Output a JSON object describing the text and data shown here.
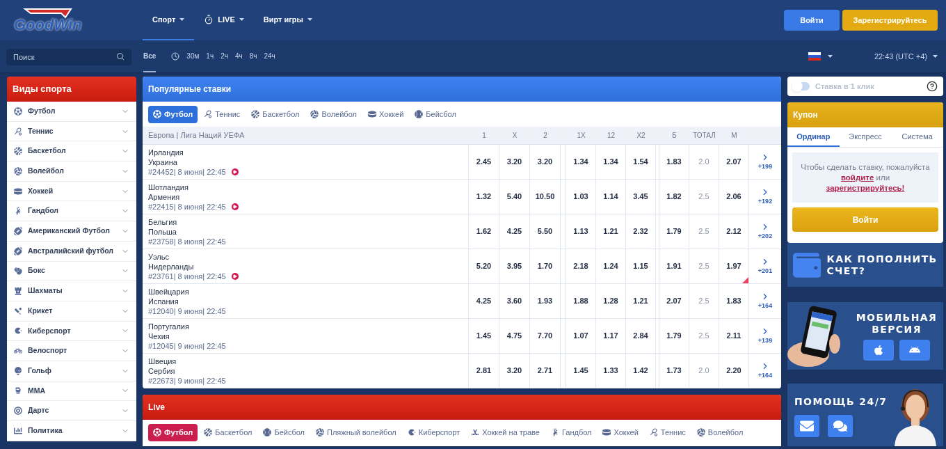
{
  "header": {
    "logo": {
      "part1": "Good",
      "part2": "Win"
    },
    "nav": [
      {
        "label": "Спорт",
        "selected": true,
        "kind": "plain"
      },
      {
        "label": "LIVE",
        "selected": false,
        "kind": "live"
      },
      {
        "label": "Вирт игры",
        "selected": false,
        "kind": "plain"
      }
    ],
    "login": "Войти",
    "register": "Зарегистрируйтесь"
  },
  "subbar": {
    "search": {
      "placeholder": "Поиск"
    },
    "filters": [
      {
        "label": "Все",
        "selected": true
      },
      {
        "label": "30м",
        "selected": false
      },
      {
        "label": "1ч",
        "selected": false
      },
      {
        "label": "2ч",
        "selected": false
      },
      {
        "label": "4ч",
        "selected": false
      },
      {
        "label": "8ч",
        "selected": false
      },
      {
        "label": "24ч",
        "selected": false
      }
    ],
    "time": "22:43 (UTC +4)"
  },
  "sidebar": {
    "title": "Виды спорта",
    "items": [
      {
        "label": "Футбол",
        "kind": "football"
      },
      {
        "label": "Теннис",
        "kind": "tennis"
      },
      {
        "label": "Баскетбол",
        "kind": "basketball"
      },
      {
        "label": "Волейбол",
        "kind": "volleyball"
      },
      {
        "label": "Хоккей",
        "kind": "hockey"
      },
      {
        "label": "Гандбол",
        "kind": "handball"
      },
      {
        "label": "Американский Футбол",
        "kind": "american"
      },
      {
        "label": "Австралийский футбол",
        "kind": "american"
      },
      {
        "label": "Бокс",
        "kind": "boxing"
      },
      {
        "label": "Шахматы",
        "kind": "chess"
      },
      {
        "label": "Крикет",
        "kind": "cricket"
      },
      {
        "label": "Киберспорт",
        "kind": "esports"
      },
      {
        "label": "Велоспорт",
        "kind": "cycling"
      },
      {
        "label": "Гольф",
        "kind": "golf"
      },
      {
        "label": "MMA",
        "kind": "mma"
      },
      {
        "label": "Дартс",
        "kind": "darts"
      },
      {
        "label": "Политика",
        "kind": "politics"
      }
    ]
  },
  "popular": {
    "title": "Популярные ставки",
    "tabs": [
      {
        "label": "Футбол",
        "kind": "football",
        "selected": true
      },
      {
        "label": "Теннис",
        "kind": "tennis",
        "selected": false
      },
      {
        "label": "Баскетбол",
        "kind": "basketball",
        "selected": false
      },
      {
        "label": "Волейбол",
        "kind": "volleyball",
        "selected": false
      },
      {
        "label": "Хоккей",
        "kind": "hockey",
        "selected": false
      },
      {
        "label": "Бейсбол",
        "kind": "baseball",
        "selected": false
      }
    ],
    "league": "Европа | Лига Наций УЕФА",
    "columns": [
      "1",
      "X",
      "2",
      "1X",
      "12",
      "X2",
      "Б",
      "ТОТАЛ",
      "М"
    ],
    "rows": [
      {
        "team1": "Ирландия",
        "team2": "Украина",
        "meta": "#24452| 8 июня| 22:45",
        "live": true,
        "changed": false,
        "odds": [
          "2.45",
          "3.20",
          "3.20",
          "1.34",
          "1.34",
          "1.54",
          "1.83",
          "2.0",
          "2.07"
        ],
        "more": "+199"
      },
      {
        "team1": "Шотландия",
        "team2": "Армения",
        "meta": "#22415| 8 июня| 22:45",
        "live": true,
        "changed": false,
        "odds": [
          "1.32",
          "5.40",
          "10.50",
          "1.03",
          "1.14",
          "3.45",
          "1.82",
          "2.5",
          "2.06"
        ],
        "more": "+192"
      },
      {
        "team1": "Бельгия",
        "team2": "Польша",
        "meta": "#23758| 8 июня| 22:45",
        "live": false,
        "changed": false,
        "odds": [
          "1.62",
          "4.25",
          "5.50",
          "1.13",
          "1.21",
          "2.32",
          "1.79",
          "2.5",
          "2.12"
        ],
        "more": "+202"
      },
      {
        "team1": "Уэльс",
        "team2": "Нидерланды",
        "meta": "#23761| 8 июня| 22:45",
        "live": true,
        "changed": true,
        "odds": [
          "5.20",
          "3.95",
          "1.70",
          "2.18",
          "1.24",
          "1.15",
          "1.91",
          "2.5",
          "1.97"
        ],
        "more": "+201"
      },
      {
        "team1": "Швейцария",
        "team2": "Испания",
        "meta": "#12040| 9 июня| 22:45",
        "live": false,
        "changed": false,
        "odds": [
          "4.25",
          "3.60",
          "1.93",
          "1.88",
          "1.28",
          "1.21",
          "2.07",
          "2.5",
          "1.83"
        ],
        "more": "+164"
      },
      {
        "team1": "Португалия",
        "team2": "Чехия",
        "meta": "#12045| 9 июня| 22:45",
        "live": false,
        "changed": false,
        "odds": [
          "1.45",
          "4.75",
          "7.70",
          "1.07",
          "1.17",
          "2.84",
          "1.79",
          "2.5",
          "2.11"
        ],
        "more": "+139"
      },
      {
        "team1": "Швеция",
        "team2": "Сербия",
        "meta": "#22673| 9 июня| 22:45",
        "live": false,
        "changed": false,
        "odds": [
          "2.81",
          "3.20",
          "2.71",
          "1.45",
          "1.33",
          "1.42",
          "1.73",
          "2.0",
          "2.20"
        ],
        "more": "+164"
      }
    ]
  },
  "live": {
    "title": "Live",
    "tabs": [
      {
        "label": "Футбол",
        "kind": "football",
        "selected": true
      },
      {
        "label": "Баскетбол",
        "kind": "basketball",
        "selected": false
      },
      {
        "label": "Бейсбол",
        "kind": "baseball",
        "selected": false
      },
      {
        "label": "Пляжный волейбол",
        "kind": "volleyball",
        "selected": false
      },
      {
        "label": "Киберспорт",
        "kind": "esports",
        "selected": false
      },
      {
        "label": "Хоккей на траве",
        "kind": "fieldhockey",
        "selected": false
      },
      {
        "label": "Гандбол",
        "kind": "handball",
        "selected": false
      },
      {
        "label": "Хоккей",
        "kind": "hockey",
        "selected": false
      },
      {
        "label": "Теннис",
        "kind": "tennis",
        "selected": false
      },
      {
        "label": "Волейбол",
        "kind": "volleyball",
        "selected": false
      }
    ]
  },
  "right": {
    "one_click": {
      "label": "Ставка в 1 клик",
      "on": false
    },
    "coupon": {
      "title": "Купон",
      "tabs": [
        {
          "label": "Ординар",
          "selected": true
        },
        {
          "label": "Экспресс",
          "selected": false
        },
        {
          "label": "Система",
          "selected": false
        }
      ],
      "message": {
        "before": "Чтобы сделать ставку, пожалуйста",
        "link1": "войдите",
        "middle": "или",
        "link2": "зарегистрируйтесь!"
      },
      "button": "Войти"
    },
    "banners": [
      {
        "kind": "deposit",
        "text": "КАК ПОПОЛНИТЬ СЧЕТ?"
      },
      {
        "kind": "mobile",
        "text": "МОБИЛЬНАЯ ВЕРСИЯ"
      },
      {
        "kind": "help",
        "text": "ПОМОЩЬ 24/7"
      }
    ]
  }
}
